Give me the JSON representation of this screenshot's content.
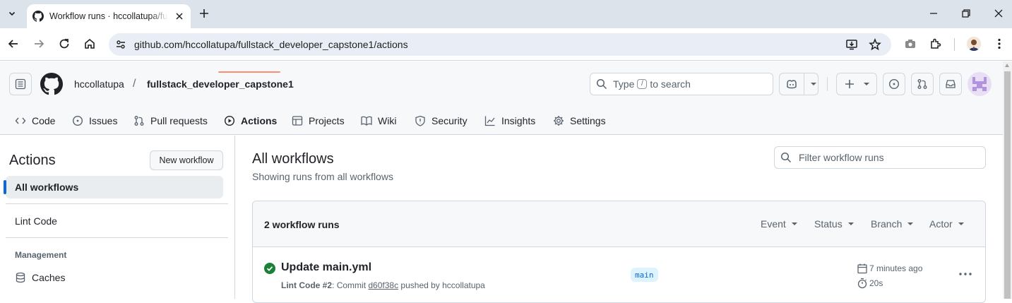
{
  "browser": {
    "tab_title": "Workflow runs · hccollatupa/fullstack_developer_capstone1",
    "url": "github.com/hccollatupa/fullstack_developer_capstone1/actions"
  },
  "header": {
    "owner": "hccollatupa",
    "separator": "/",
    "repo": "fullstack_developer_capstone1",
    "search_prefix": "Type",
    "search_key": "/",
    "search_suffix": "to search"
  },
  "repo_nav": [
    {
      "label": "Code",
      "icon": "code-icon"
    },
    {
      "label": "Issues",
      "icon": "issue-icon"
    },
    {
      "label": "Pull requests",
      "icon": "pull-request-icon"
    },
    {
      "label": "Actions",
      "icon": "play-icon",
      "active": true
    },
    {
      "label": "Projects",
      "icon": "table-icon"
    },
    {
      "label": "Wiki",
      "icon": "book-icon"
    },
    {
      "label": "Security",
      "icon": "shield-icon"
    },
    {
      "label": "Insights",
      "icon": "graph-icon"
    },
    {
      "label": "Settings",
      "icon": "gear-icon"
    }
  ],
  "sidebar": {
    "title": "Actions",
    "new_workflow": "New workflow",
    "items": [
      {
        "label": "All workflows",
        "selected": true
      },
      {
        "label": "Lint Code"
      }
    ],
    "management_heading": "Management",
    "management_items": [
      {
        "label": "Caches",
        "icon": "database-icon"
      }
    ]
  },
  "main": {
    "title": "All workflows",
    "subtitle": "Showing runs from all workflows",
    "filter_placeholder": "Filter workflow runs",
    "runs_count": "2 workflow runs",
    "filters": [
      "Event",
      "Status",
      "Branch",
      "Actor"
    ],
    "runs": [
      {
        "title": "Update main.yml",
        "workflow": "Lint Code",
        "run_number": "#2",
        "commit_prefix": ": Commit",
        "sha": "d60f38c",
        "pushed_by": "pushed by hccollatupa",
        "branch": "main",
        "time": "7 minutes ago",
        "duration": "20s",
        "status_color": "#1a7f37"
      }
    ]
  },
  "colors": {
    "accent": "#fd8c73",
    "link": "#0969da",
    "success": "#1a7f37"
  }
}
